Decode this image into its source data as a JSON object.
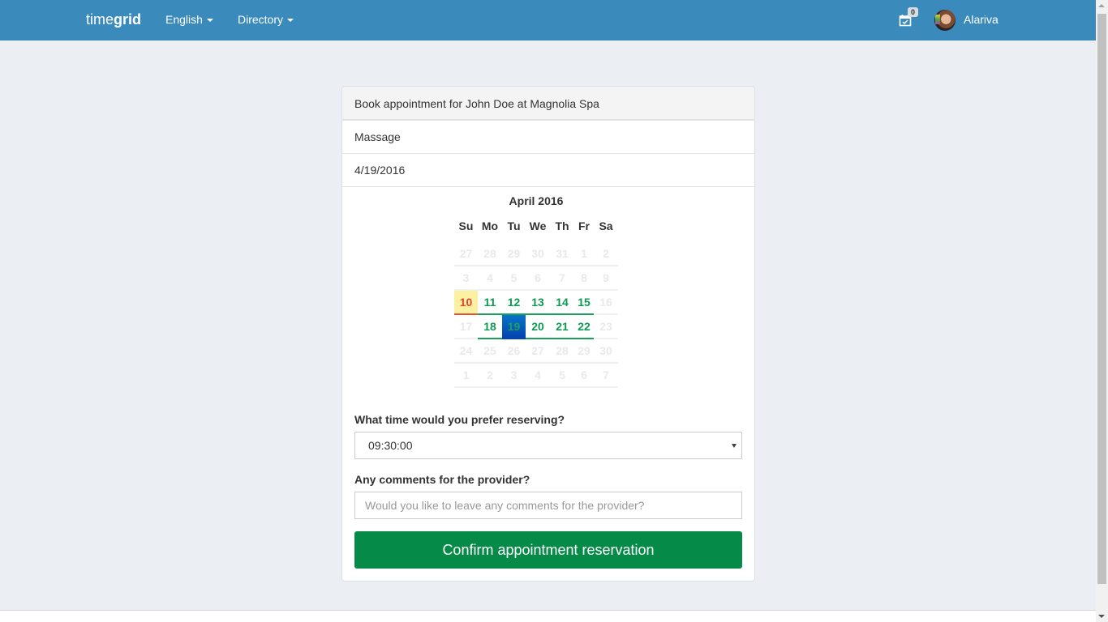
{
  "navbar": {
    "brand_light": "time",
    "brand_bold": "grid",
    "language_label": "English",
    "directory_label": "Directory",
    "appointments_badge": "0",
    "user_name": "Alariva",
    "colors": {
      "navbar_bg": "#3a8bbb"
    }
  },
  "panel": {
    "heading": "Book appointment for John Doe at Magnolia Spa",
    "service": "Massage",
    "date": "4/19/2016"
  },
  "calendar": {
    "title": "April 2016",
    "weekdays": [
      "Su",
      "Mo",
      "Tu",
      "We",
      "Th",
      "Fr",
      "Sa"
    ],
    "weeks": [
      [
        {
          "d": "27",
          "s": "muted"
        },
        {
          "d": "28",
          "s": "muted"
        },
        {
          "d": "29",
          "s": "muted"
        },
        {
          "d": "30",
          "s": "muted"
        },
        {
          "d": "31",
          "s": "muted"
        },
        {
          "d": "1",
          "s": "muted"
        },
        {
          "d": "2",
          "s": "muted"
        }
      ],
      [
        {
          "d": "3",
          "s": "muted"
        },
        {
          "d": "4",
          "s": "muted"
        },
        {
          "d": "5",
          "s": "muted"
        },
        {
          "d": "6",
          "s": "muted"
        },
        {
          "d": "7",
          "s": "muted"
        },
        {
          "d": "8",
          "s": "muted"
        },
        {
          "d": "9",
          "s": "muted"
        }
      ],
      [
        {
          "d": "10",
          "s": "today"
        },
        {
          "d": "11",
          "s": "avail"
        },
        {
          "d": "12",
          "s": "avail"
        },
        {
          "d": "13",
          "s": "avail"
        },
        {
          "d": "14",
          "s": "avail"
        },
        {
          "d": "15",
          "s": "avail"
        },
        {
          "d": "16",
          "s": "muted"
        }
      ],
      [
        {
          "d": "17",
          "s": "muted"
        },
        {
          "d": "18",
          "s": "avail"
        },
        {
          "d": "19",
          "s": "selected"
        },
        {
          "d": "20",
          "s": "avail"
        },
        {
          "d": "21",
          "s": "avail"
        },
        {
          "d": "22",
          "s": "avail"
        },
        {
          "d": "23",
          "s": "muted"
        }
      ],
      [
        {
          "d": "24",
          "s": "muted"
        },
        {
          "d": "25",
          "s": "muted"
        },
        {
          "d": "26",
          "s": "muted"
        },
        {
          "d": "27",
          "s": "muted"
        },
        {
          "d": "28",
          "s": "muted"
        },
        {
          "d": "29",
          "s": "muted"
        },
        {
          "d": "30",
          "s": "muted"
        }
      ],
      [
        {
          "d": "1",
          "s": "muted"
        },
        {
          "d": "2",
          "s": "muted"
        },
        {
          "d": "3",
          "s": "muted"
        },
        {
          "d": "4",
          "s": "muted"
        },
        {
          "d": "5",
          "s": "muted"
        },
        {
          "d": "6",
          "s": "muted"
        },
        {
          "d": "7",
          "s": "muted"
        }
      ]
    ]
  },
  "form": {
    "time_label": "What time would you prefer reserving?",
    "time_value": "09:30:00",
    "comments_label": "Any comments for the provider?",
    "comments_placeholder": "Would you like to leave any comments for the provider?",
    "comments_value": "",
    "confirm_label": "Confirm appointment reservation",
    "colors": {
      "confirm_bg": "#068a48",
      "available": "#0c9a52",
      "today": "#e14535",
      "selected": "#0a5cc0"
    }
  }
}
